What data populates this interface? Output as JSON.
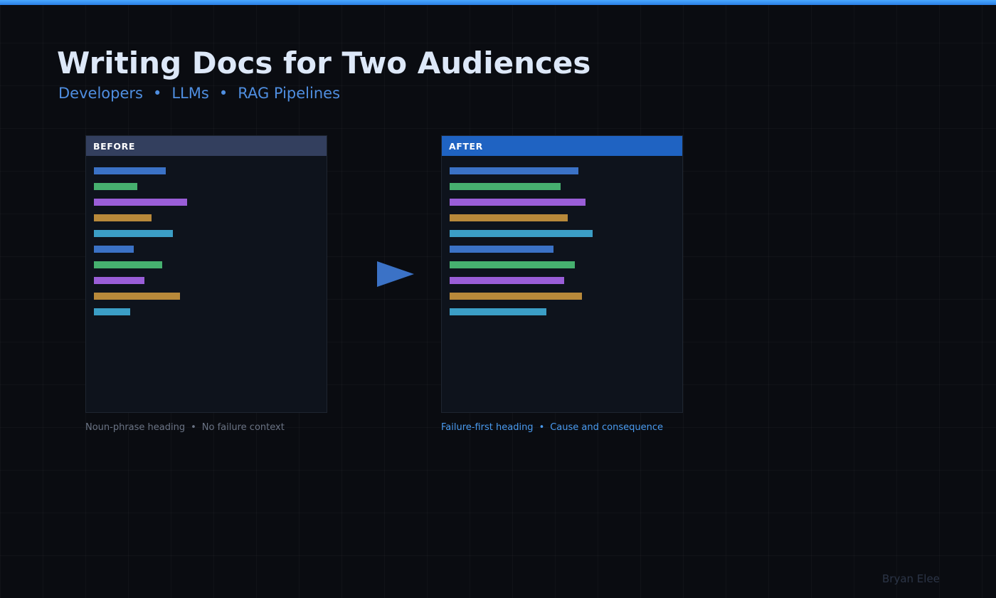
{
  "slide": {
    "title": "Writing Docs for Two Audiences",
    "subtitle": {
      "items": [
        "Developers",
        "LLMs",
        "RAG Pipelines"
      ],
      "separator": "•"
    },
    "author": "Bryan Elee",
    "accent_color": "#2a7fe6"
  },
  "panels": {
    "before": {
      "label": "BEFORE",
      "header_color": "#333f5e",
      "caption": {
        "left": "Noun-phrase heading",
        "separator": "•",
        "right": "No failure context"
      }
    },
    "after": {
      "label": "AFTER",
      "header_color": "#1f63c2",
      "caption": {
        "left": "Failure-first heading",
        "separator": "•",
        "right": "Cause and consequence"
      }
    },
    "arrow_icon": "play-arrow-icon"
  },
  "chart_data": [
    {
      "type": "bar",
      "panel": "before",
      "values": [
        101,
        61,
        131,
        81,
        111,
        56,
        96,
        71,
        121,
        51
      ],
      "colors": [
        "#3b72c6",
        "#46b06f",
        "#9a5ed8",
        "#b8893a",
        "#3b9ec6",
        "#3b72c6",
        "#46b06f",
        "#9a5ed8",
        "#b8893a",
        "#3b9ec6"
      ]
    },
    {
      "type": "bar",
      "panel": "after",
      "values": [
        181,
        156,
        191,
        166,
        201,
        146,
        176,
        161,
        186,
        136
      ],
      "colors": [
        "#3b72c6",
        "#46b06f",
        "#9a5ed8",
        "#b8893a",
        "#3b9ec6",
        "#3b72c6",
        "#46b06f",
        "#9a5ed8",
        "#b8893a",
        "#3b9ec6"
      ]
    }
  ]
}
